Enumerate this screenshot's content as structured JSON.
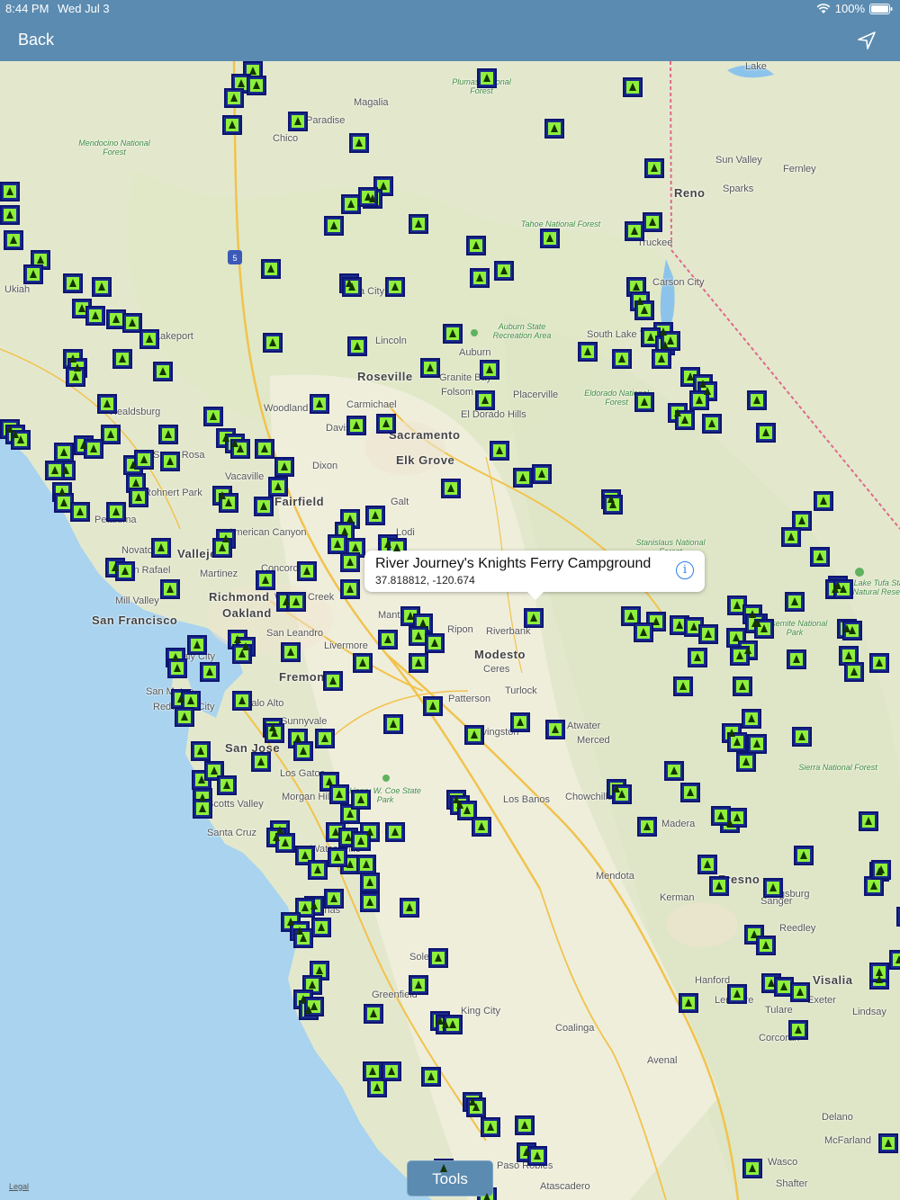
{
  "status_bar": {
    "time": "8:44 PM",
    "date": "Wed Jul 3",
    "battery": "100%"
  },
  "nav": {
    "back_label": "Back",
    "locate_icon": "location-arrow-icon"
  },
  "callout": {
    "title": "River Journey's Knights Ferry Campground",
    "coords": "37.818812, -120.674",
    "info_icon": "info-icon"
  },
  "toolbar": {
    "tools_label": "Tools"
  },
  "legal": "Legal",
  "map": {
    "pin_icon": "campground-tent-icon",
    "colors": {
      "pin_outer": "#1a2b8f",
      "pin_inner": "#8ef03a",
      "nav": "#5b8bb0",
      "ocean": "#a9d3ee"
    },
    "labels": [
      "Lake",
      "Plumas National Forest",
      "Magalia",
      "Paradise",
      "Chico",
      "Mendocino National Forest",
      "Sun Valley",
      "Fernley",
      "Reno",
      "Sparks",
      "Tahoe National Forest",
      "Truckee",
      "Carson City",
      "Ukiah",
      "Lakeport",
      "Yuba City",
      "Lincoln",
      "Auburn State Recreation Area",
      "South Lake Tahoe",
      "Auburn",
      "Roseville",
      "Granite Bay",
      "Folsom",
      "Placerville",
      "Carmichael",
      "Eldorado National Forest",
      "El Dorado Hills",
      "Woodland",
      "Davis",
      "Sacramento",
      "Healdsburg",
      "Santa Rosa",
      "Vacaville",
      "Dixon",
      "Elk Grove",
      "Rohnert Park",
      "Fairfield",
      "Galt",
      "Petaluma",
      "American Canyon",
      "Novato",
      "Vallejo",
      "Lodi",
      "Stanislaus National Forest",
      "San Rafael",
      "Martinez",
      "Concord",
      "Mill Valley",
      "Walnut Creek",
      "Richmond",
      "San Francisco",
      "Oakland",
      "Manteca",
      "Ripon",
      "Riverbank",
      "San Leandro",
      "Livermore",
      "Modesto",
      "Daly City",
      "Fremont",
      "Ceres",
      "San Mateo",
      "Redwood City",
      "Palo Alto",
      "Patterson",
      "Turlock",
      "Sunnyvale",
      "San Jose",
      "Livingston",
      "Atwater",
      "Merced",
      "Los Gatos",
      "Henry W. Coe State Park",
      "Scotts Valley",
      "Morgan Hill",
      "Los Banos",
      "Chowchilla",
      "Santa Cruz",
      "Madera",
      "Watsonville",
      "Mendota",
      "Fresno",
      "Kerman",
      "Salinas",
      "Sanger",
      "Reedley",
      "Soledad",
      "Hanford",
      "Visalia",
      "Greenfield",
      "Lemoore",
      "Exeter",
      "King City",
      "Tulare",
      "Lindsay",
      "Coalinga",
      "Corcoran",
      "Avenal",
      "Delano",
      "McFarland",
      "Wasco",
      "Shafter",
      "Paso Robles",
      "Atascadero",
      "Sierra National Forest",
      "Yosemite National Park",
      "Lake Tufa State Natural Reserve",
      "Kingsburg"
    ]
  }
}
